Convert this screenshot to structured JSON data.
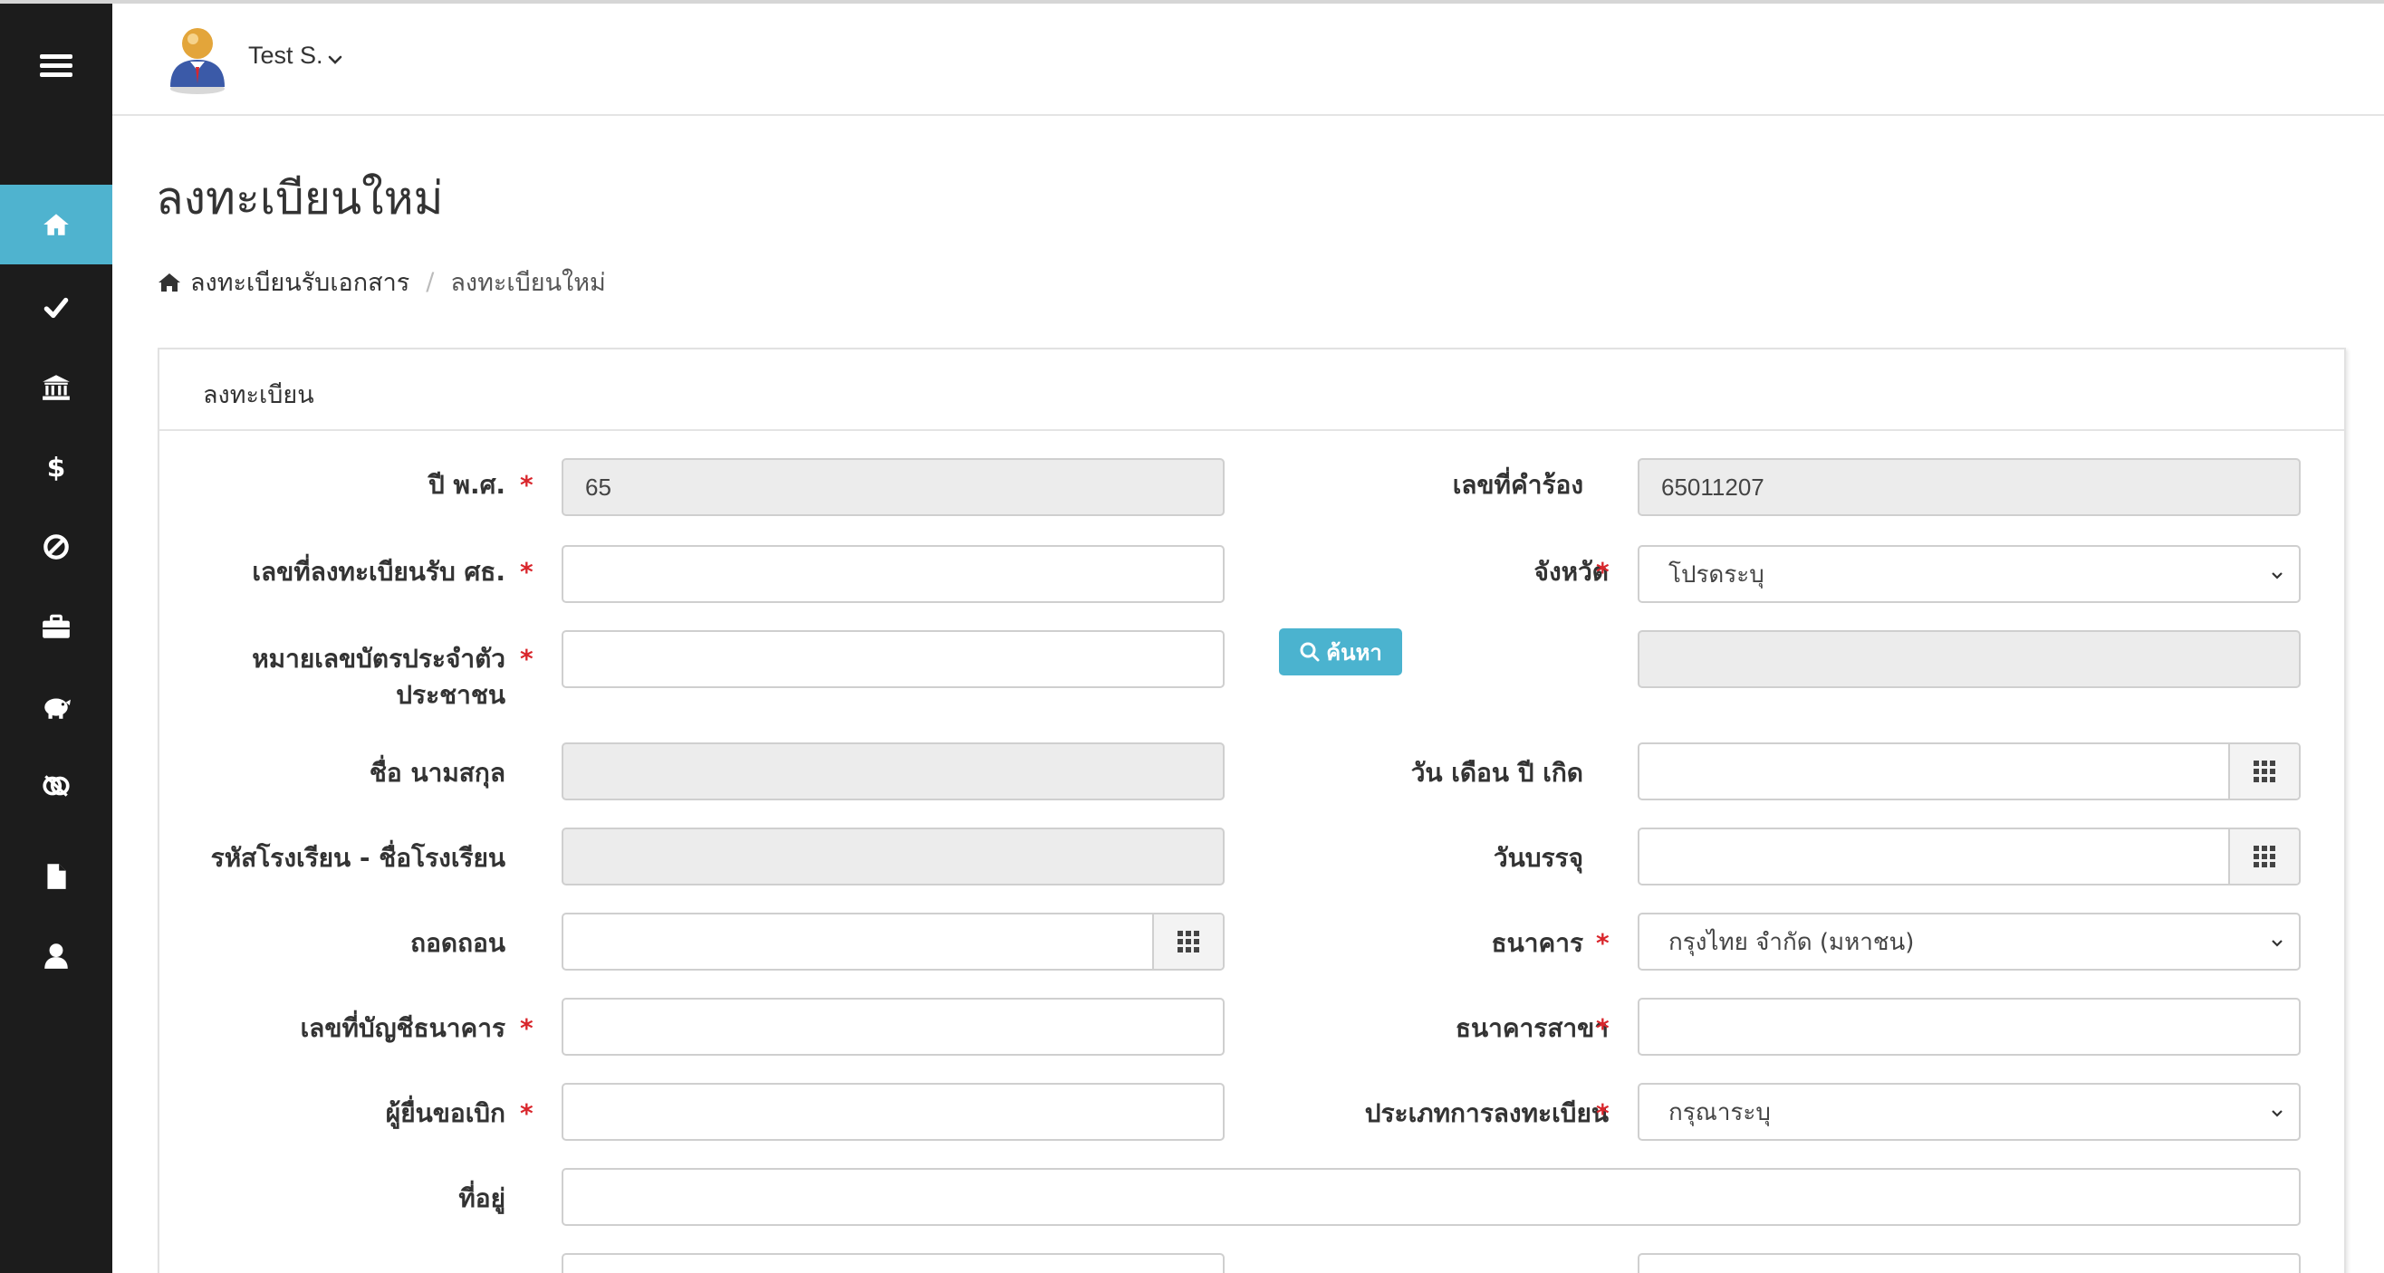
{
  "user": {
    "name": "Test S."
  },
  "page": {
    "title": "ลงทะเบียนใหม่"
  },
  "breadcrumb": {
    "home_label": "ลงทะเบียนรับเอกสาร",
    "current": "ลงทะเบียนใหม่"
  },
  "panel": {
    "title": "ลงทะเบียน"
  },
  "sidebar": {
    "items": [
      {
        "icon": "home-icon",
        "active": true
      },
      {
        "icon": "check-icon"
      },
      {
        "icon": "bank-icon"
      },
      {
        "icon": "dollar-icon"
      },
      {
        "icon": "ban-icon"
      },
      {
        "icon": "briefcase-icon"
      },
      {
        "icon": "piggy-bank-icon"
      },
      {
        "icon": "link-icon"
      },
      {
        "icon": "file-icon"
      },
      {
        "icon": "user-icon"
      }
    ]
  },
  "form": {
    "year": {
      "label": "ปี พ.ศ.",
      "value": "65"
    },
    "request_no": {
      "label": "เลขที่คำร้อง",
      "value": "65011207"
    },
    "reg_no": {
      "label": "เลขที่ลงทะเบียนรับ ศธ.",
      "value": ""
    },
    "province": {
      "label": "จังหวัด",
      "value": "โปรดระบุ"
    },
    "id_card": {
      "label_line1": "หมายเลขบัตรประจำตัว",
      "label_line2": "ประชาชน",
      "value": ""
    },
    "search_button": "ค้นหา",
    "full_name": {
      "label": "ชื่อ นามสกุล",
      "value": ""
    },
    "birth_date": {
      "label": "วัน เดือน ปี เกิด",
      "value": ""
    },
    "school": {
      "label": "รหัสโรงเรียน - ชื่อโรงเรียน",
      "value": ""
    },
    "appoint_date": {
      "label": "วันบรรจุ",
      "value": ""
    },
    "withdraw": {
      "label": "ถอดถอน",
      "value": ""
    },
    "bank": {
      "label": "ธนาคาร",
      "value": "กรุงไทย จำกัด (มหาชน)"
    },
    "account_no": {
      "label": "เลขที่บัญชีธนาคาร",
      "value": ""
    },
    "branch": {
      "label": "ธนาคารสาขา",
      "value": ""
    },
    "applicant": {
      "label": "ผู้ยื่นขอเบิก",
      "value": ""
    },
    "reg_type": {
      "label": "ประเภทการลงทะเบียน",
      "value": "กรุณาระบุ"
    },
    "address": {
      "label": "ที่อยู่",
      "value": ""
    }
  },
  "colors": {
    "accent": "#4fb3cf",
    "sidebar": "#1c1c1c",
    "required": "#d9262c"
  }
}
